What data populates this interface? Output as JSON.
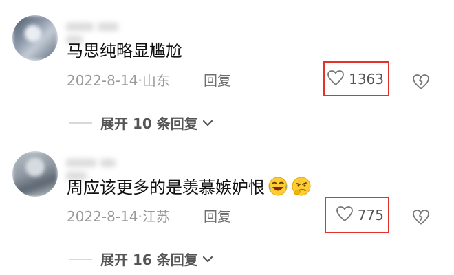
{
  "comments": [
    {
      "text": "马思纯略显尴尬",
      "date": "2022-8-14",
      "separator": "·",
      "location": "山东",
      "reply_label": "回复",
      "likes": "1363",
      "expand_label": "展开 10 条回复"
    },
    {
      "text": "周应该更多的是羡慕嫉妒恨",
      "date": "2022-8-14",
      "separator": "·",
      "location": "江苏",
      "reply_label": "回复",
      "likes": "775",
      "expand_label": "展开 16 条回复"
    }
  ],
  "emojis": [
    "laughing-crying-emoji",
    "smirk-thinking-emoji"
  ],
  "colors": {
    "highlight_box": "#e5322d",
    "meta_text": "#9a9a9a",
    "body_text": "#111111"
  }
}
